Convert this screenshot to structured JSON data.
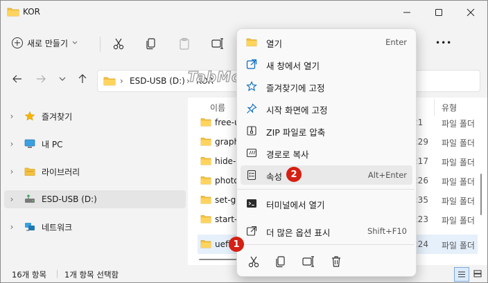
{
  "window": {
    "title": "KOR"
  },
  "toolbar": {
    "new_label": "새로 만들기",
    "more_label": "•••"
  },
  "address": {
    "drive": "ESD-USB (D:)",
    "folder": "KOR"
  },
  "watermark": "TabMode.com",
  "nav": {
    "items": [
      {
        "label": "즐겨찾기",
        "icon": "star-icon"
      },
      {
        "label": "내 PC",
        "icon": "pc-icon"
      },
      {
        "label": "라이브러리",
        "icon": "library-icon"
      },
      {
        "label": "ESD-USB (D:)",
        "icon": "usb-drive-icon",
        "selected": true
      },
      {
        "label": "네트워크",
        "icon": "network-icon"
      }
    ]
  },
  "content": {
    "columns": {
      "name": "이름",
      "type": "유형"
    },
    "files": [
      {
        "name": "free-u",
        "date": ":21",
        "type": "파일 폴더"
      },
      {
        "name": "graph",
        "date": "3:29",
        "type": "파일 폴더"
      },
      {
        "name": "hide-e",
        "date": "1:17",
        "type": "파일 폴더"
      },
      {
        "name": "photo",
        "date": "2:26",
        "type": "파일 폴더"
      },
      {
        "name": "set-gr",
        "date": "0:35",
        "type": "파일 폴더"
      },
      {
        "name": "start-t",
        "date": "5:23",
        "type": "파일 폴더"
      },
      {
        "name": "uefi",
        "date": "5:24",
        "type": "파일 폴더",
        "selected": true
      }
    ]
  },
  "status": {
    "count": "16개 항목",
    "selection": "1개 항목 선택함"
  },
  "context_menu": {
    "items": [
      {
        "label": "열기",
        "shortcut": "Enter",
        "icon": "folder-icon"
      },
      {
        "label": "새 창에서 열기",
        "shortcut": "",
        "icon": "open-new-window-icon"
      },
      {
        "label": "즐겨찾기에 고정",
        "shortcut": "",
        "icon": "star-outline-icon"
      },
      {
        "label": "시작 화면에 고정",
        "shortcut": "",
        "icon": "pin-icon"
      },
      {
        "label": "ZIP 파일로 압축",
        "shortcut": "",
        "icon": "zip-icon"
      },
      {
        "label": "경로로 복사",
        "shortcut": "",
        "icon": "copy-path-icon"
      },
      {
        "label": "속성",
        "shortcut": "Alt+Enter",
        "icon": "properties-icon",
        "highlighted": true
      },
      {
        "label": "터미널에서 열기",
        "shortcut": "",
        "icon": "terminal-icon"
      },
      {
        "label": "더 많은 옵션 표시",
        "shortcut": "Shift+F10",
        "icon": "more-options-icon"
      }
    ]
  },
  "badges": {
    "one": "1",
    "two": "2"
  },
  "colors": {
    "accent": "#0067c0",
    "folder": "#f5c142",
    "badge": "#d52014",
    "selection": "#e5f0fb"
  }
}
